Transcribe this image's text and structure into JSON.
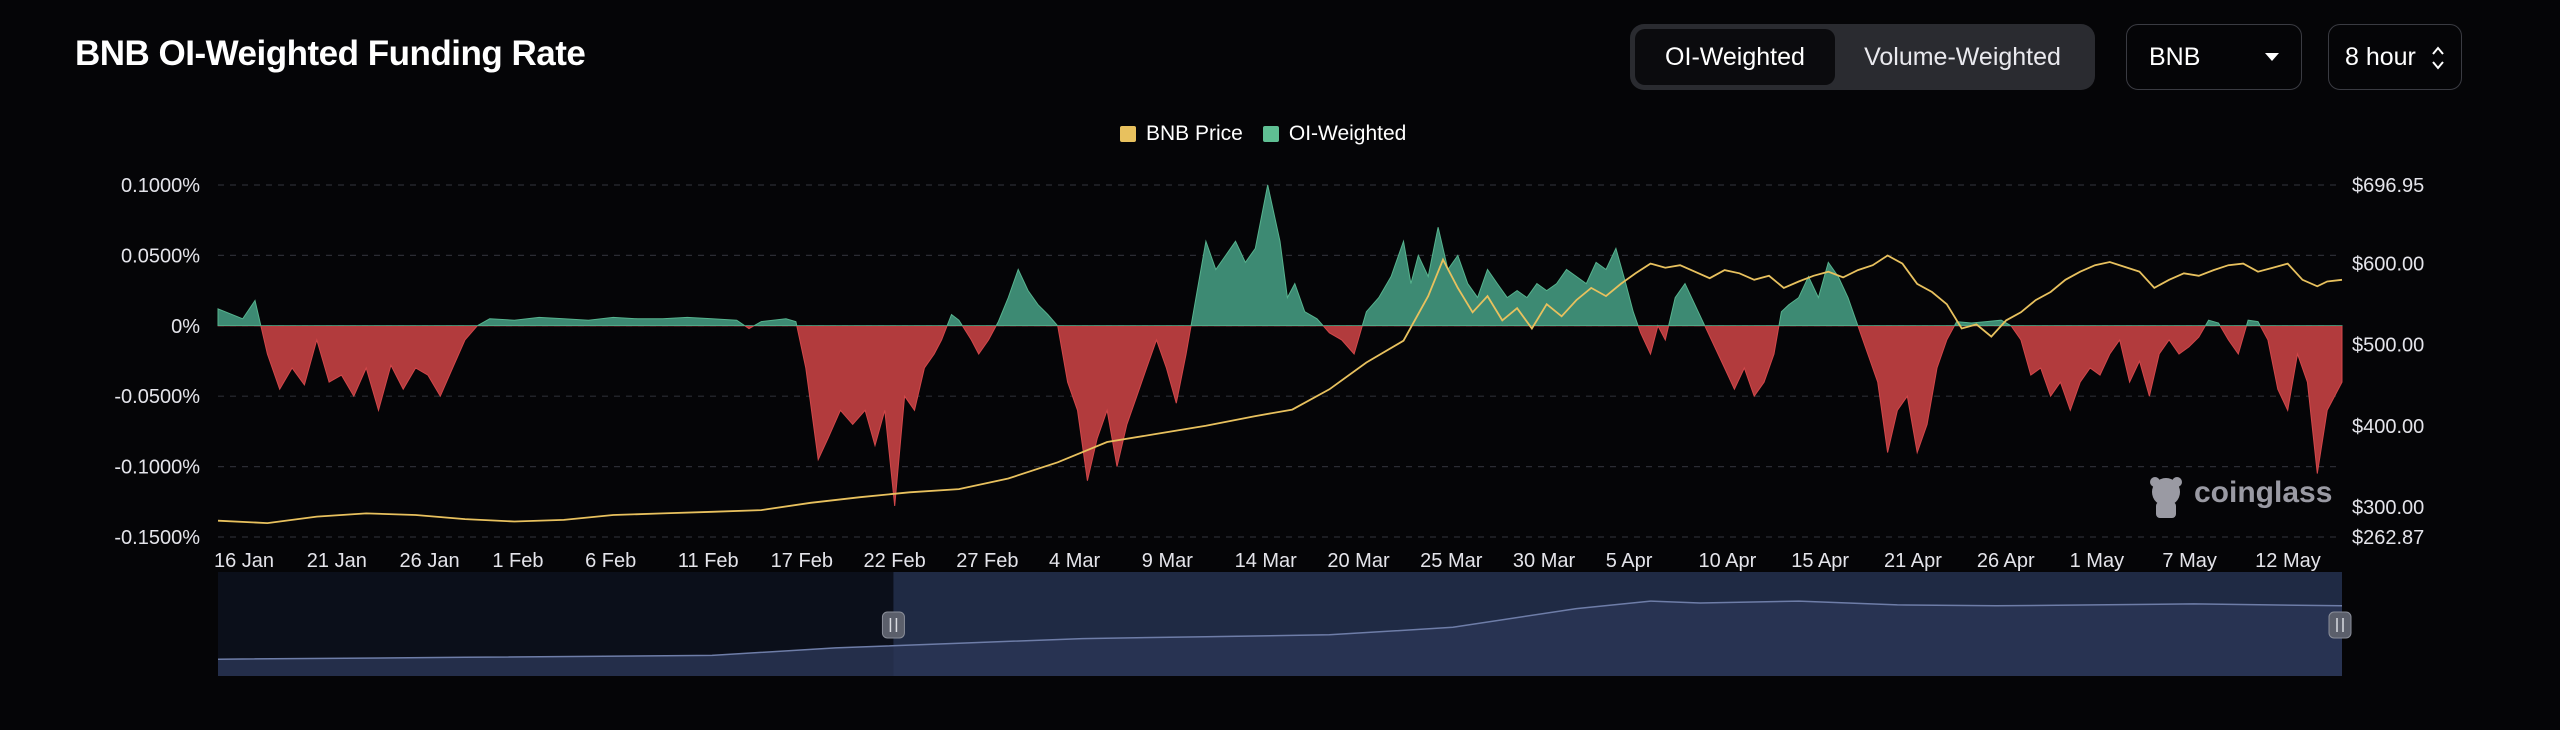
{
  "header": {
    "title": "BNB OI-Weighted Funding Rate",
    "tabs": [
      {
        "label": "OI-Weighted",
        "active": true
      },
      {
        "label": "Volume-Weighted",
        "active": false
      }
    ],
    "coin_select": {
      "value": "BNB",
      "icon": "chevron-down-icon"
    },
    "interval_select": {
      "value": "8 hour",
      "icon": "up-down-icon"
    }
  },
  "watermark": {
    "text": "coinglass"
  },
  "colors": {
    "background": "#050507",
    "positive": "#3d8a73",
    "negative": "#b23b3d",
    "price": "#e8c15e",
    "grid": "#2b2c33",
    "navigator_fill": "#1f2a44",
    "navigator_line": "#6e7da8"
  },
  "chart_data": {
    "type": "area",
    "legend": [
      "BNB Price",
      "OI-Weighted"
    ],
    "legend_position": "top-center",
    "grid": true,
    "y_left_ticks": [
      "0.1000%",
      "0.0500%",
      "0%",
      "-0.0500%",
      "-0.1000%",
      "-0.1500%"
    ],
    "y_left_tick_values": [
      0.1,
      0.05,
      0,
      -0.05,
      -0.1,
      -0.15
    ],
    "ylim_left": [
      -0.15,
      0.1
    ],
    "y_right_ticks": [
      "$696.95",
      "$600.00",
      "$500.00",
      "$400.00",
      "$300.00",
      "$262.87"
    ],
    "y_right_tick_values": [
      696.95,
      600,
      500,
      400,
      300,
      262.87
    ],
    "ylim_right": [
      262.87,
      696.95
    ],
    "x_ticks": [
      "16 Jan",
      "21 Jan",
      "26 Jan",
      "1 Feb",
      "6 Feb",
      "11 Feb",
      "17 Feb",
      "22 Feb",
      "27 Feb",
      "4 Mar",
      "9 Mar",
      "14 Mar",
      "20 Mar",
      "25 Mar",
      "30 Mar",
      "5 Apr",
      "10 Apr",
      "15 Apr",
      "21 Apr",
      "26 Apr",
      "1 May",
      "7 May",
      "12 May"
    ],
    "series": [
      {
        "name": "OI-Weighted",
        "unit": "%",
        "points": [
          [
            0,
            0.012
          ],
          [
            1,
            0.005
          ],
          [
            1.5,
            0.018
          ],
          [
            2,
            -0.02
          ],
          [
            2.5,
            -0.045
          ],
          [
            3,
            -0.03
          ],
          [
            3.5,
            -0.042
          ],
          [
            4,
            -0.01
          ],
          [
            4.5,
            -0.04
          ],
          [
            5,
            -0.035
          ],
          [
            5.5,
            -0.05
          ],
          [
            6,
            -0.03
          ],
          [
            6.5,
            -0.06
          ],
          [
            7,
            -0.028
          ],
          [
            7.5,
            -0.045
          ],
          [
            8,
            -0.03
          ],
          [
            8.5,
            -0.035
          ],
          [
            9,
            -0.05
          ],
          [
            9.5,
            -0.03
          ],
          [
            10,
            -0.01
          ],
          [
            10.5,
            0.0
          ],
          [
            11,
            0.005
          ],
          [
            12,
            0.004
          ],
          [
            13,
            0.006
          ],
          [
            14,
            0.005
          ],
          [
            15,
            0.004
          ],
          [
            16,
            0.006
          ],
          [
            17,
            0.005
          ],
          [
            18,
            0.005
          ],
          [
            19,
            0.006
          ],
          [
            20,
            0.005
          ],
          [
            21,
            0.004
          ],
          [
            21.5,
            -0.002
          ],
          [
            22,
            0.003
          ],
          [
            23,
            0.005
          ],
          [
            23.4,
            0.003
          ],
          [
            23.8,
            -0.03
          ],
          [
            24.3,
            -0.095
          ],
          [
            24.7,
            -0.08
          ],
          [
            25.2,
            -0.06
          ],
          [
            25.7,
            -0.07
          ],
          [
            26.2,
            -0.06
          ],
          [
            26.6,
            -0.085
          ],
          [
            27,
            -0.06
          ],
          [
            27.4,
            -0.128
          ],
          [
            27.8,
            -0.05
          ],
          [
            28.2,
            -0.06
          ],
          [
            28.6,
            -0.03
          ],
          [
            29,
            -0.02
          ],
          [
            29.3,
            -0.01
          ],
          [
            29.7,
            0.008
          ],
          [
            30,
            0.004
          ],
          [
            30.5,
            -0.01
          ],
          [
            30.8,
            -0.02
          ],
          [
            31.2,
            -0.01
          ],
          [
            31.6,
            0.003
          ],
          [
            32,
            0.02
          ],
          [
            32.4,
            0.04
          ],
          [
            32.8,
            0.025
          ],
          [
            33.2,
            0.015
          ],
          [
            33.6,
            0.008
          ],
          [
            34,
            0.0
          ],
          [
            34.4,
            -0.04
          ],
          [
            34.8,
            -0.06
          ],
          [
            35.2,
            -0.11
          ],
          [
            35.6,
            -0.08
          ],
          [
            36,
            -0.06
          ],
          [
            36.4,
            -0.1
          ],
          [
            36.8,
            -0.07
          ],
          [
            37.2,
            -0.05
          ],
          [
            37.6,
            -0.03
          ],
          [
            38,
            -0.01
          ],
          [
            38.4,
            -0.03
          ],
          [
            38.8,
            -0.055
          ],
          [
            39.2,
            -0.02
          ],
          [
            39.6,
            0.02
          ],
          [
            40,
            0.06
          ],
          [
            40.4,
            0.04
          ],
          [
            40.8,
            0.05
          ],
          [
            41.2,
            0.06
          ],
          [
            41.6,
            0.045
          ],
          [
            42,
            0.055
          ],
          [
            42.5,
            0.1
          ],
          [
            43,
            0.06
          ],
          [
            43.3,
            0.02
          ],
          [
            43.6,
            0.03
          ],
          [
            44,
            0.01
          ],
          [
            44.5,
            0.005
          ],
          [
            45,
            -0.005
          ],
          [
            45.5,
            -0.01
          ],
          [
            46,
            -0.02
          ],
          [
            46.5,
            0.01
          ],
          [
            47,
            0.02
          ],
          [
            47.5,
            0.035
          ],
          [
            48,
            0.06
          ],
          [
            48.3,
            0.03
          ],
          [
            48.6,
            0.05
          ],
          [
            49,
            0.035
          ],
          [
            49.4,
            0.07
          ],
          [
            49.8,
            0.04
          ],
          [
            50.2,
            0.05
          ],
          [
            50.6,
            0.03
          ],
          [
            51,
            0.02
          ],
          [
            51.4,
            0.04
          ],
          [
            51.8,
            0.03
          ],
          [
            52.2,
            0.02
          ],
          [
            52.6,
            0.025
          ],
          [
            53,
            0.02
          ],
          [
            53.4,
            0.03
          ],
          [
            53.8,
            0.025
          ],
          [
            54.2,
            0.03
          ],
          [
            54.6,
            0.04
          ],
          [
            55,
            0.035
          ],
          [
            55.4,
            0.03
          ],
          [
            55.8,
            0.045
          ],
          [
            56.2,
            0.04
          ],
          [
            56.6,
            0.055
          ],
          [
            57,
            0.03
          ],
          [
            57.3,
            0.01
          ],
          [
            57.6,
            -0.005
          ],
          [
            58,
            -0.02
          ],
          [
            58.3,
            0.0
          ],
          [
            58.6,
            -0.01
          ],
          [
            59,
            0.02
          ],
          [
            59.4,
            0.03
          ],
          [
            59.8,
            0.015
          ],
          [
            60.2,
            0.0
          ],
          [
            60.6,
            -0.015
          ],
          [
            61,
            -0.03
          ],
          [
            61.4,
            -0.045
          ],
          [
            61.8,
            -0.03
          ],
          [
            62.2,
            -0.05
          ],
          [
            62.6,
            -0.04
          ],
          [
            63,
            -0.02
          ],
          [
            63.3,
            0.01
          ],
          [
            63.6,
            0.015
          ],
          [
            64,
            0.02
          ],
          [
            64.4,
            0.035
          ],
          [
            64.8,
            0.02
          ],
          [
            65.2,
            0.045
          ],
          [
            65.6,
            0.035
          ],
          [
            66,
            0.02
          ],
          [
            66.4,
            0.0
          ],
          [
            66.8,
            -0.02
          ],
          [
            67.2,
            -0.04
          ],
          [
            67.6,
            -0.09
          ],
          [
            68,
            -0.06
          ],
          [
            68.4,
            -0.05
          ],
          [
            68.8,
            -0.09
          ],
          [
            69.2,
            -0.07
          ],
          [
            69.6,
            -0.03
          ],
          [
            70,
            -0.01
          ],
          [
            70.4,
            0.003
          ],
          [
            71,
            0.002
          ],
          [
            71.6,
            0.003
          ],
          [
            72.2,
            0.004
          ],
          [
            72.6,
            0.0
          ],
          [
            73,
            -0.01
          ],
          [
            73.4,
            -0.035
          ],
          [
            73.8,
            -0.03
          ],
          [
            74.2,
            -0.05
          ],
          [
            74.6,
            -0.04
          ],
          [
            75,
            -0.06
          ],
          [
            75.4,
            -0.04
          ],
          [
            75.8,
            -0.03
          ],
          [
            76.2,
            -0.035
          ],
          [
            76.6,
            -0.02
          ],
          [
            77,
            -0.01
          ],
          [
            77.4,
            -0.04
          ],
          [
            77.8,
            -0.025
          ],
          [
            78.2,
            -0.05
          ],
          [
            78.6,
            -0.02
          ],
          [
            79,
            -0.01
          ],
          [
            79.4,
            -0.02
          ],
          [
            79.8,
            -0.015
          ],
          [
            80.2,
            -0.008
          ],
          [
            80.6,
            0.004
          ],
          [
            81,
            0.002
          ],
          [
            81.4,
            -0.01
          ],
          [
            81.8,
            -0.02
          ],
          [
            82.2,
            0.004
          ],
          [
            82.6,
            0.003
          ],
          [
            83,
            -0.01
          ],
          [
            83.4,
            -0.045
          ],
          [
            83.8,
            -0.06
          ],
          [
            84.2,
            -0.02
          ],
          [
            84.6,
            -0.04
          ],
          [
            85,
            -0.105
          ],
          [
            85.4,
            -0.06
          ],
          [
            86,
            -0.04
          ]
        ]
      },
      {
        "name": "BNB Price",
        "unit": "USD",
        "points": [
          [
            0,
            283
          ],
          [
            2,
            280
          ],
          [
            4,
            288
          ],
          [
            6,
            292
          ],
          [
            8,
            290
          ],
          [
            10,
            285
          ],
          [
            12,
            282
          ],
          [
            14,
            284
          ],
          [
            16,
            290
          ],
          [
            18,
            292
          ],
          [
            20,
            294
          ],
          [
            22,
            296
          ],
          [
            24,
            305
          ],
          [
            26,
            312
          ],
          [
            28,
            318
          ],
          [
            30,
            322
          ],
          [
            32,
            335
          ],
          [
            34,
            355
          ],
          [
            36,
            380
          ],
          [
            38,
            390
          ],
          [
            40,
            400
          ],
          [
            42,
            412
          ],
          [
            43.5,
            420
          ],
          [
            45,
            445
          ],
          [
            46.5,
            478
          ],
          [
            48,
            505
          ],
          [
            49,
            560
          ],
          [
            49.6,
            605
          ],
          [
            50.2,
            570
          ],
          [
            50.8,
            540
          ],
          [
            51.4,
            560
          ],
          [
            52,
            530
          ],
          [
            52.6,
            545
          ],
          [
            53.2,
            520
          ],
          [
            53.8,
            550
          ],
          [
            54.4,
            535
          ],
          [
            55,
            555
          ],
          [
            55.6,
            570
          ],
          [
            56.2,
            560
          ],
          [
            56.8,
            575
          ],
          [
            57.4,
            588
          ],
          [
            58,
            600
          ],
          [
            58.6,
            595
          ],
          [
            59.2,
            598
          ],
          [
            59.8,
            590
          ],
          [
            60.4,
            582
          ],
          [
            61,
            592
          ],
          [
            61.6,
            588
          ],
          [
            62.2,
            580
          ],
          [
            62.8,
            585
          ],
          [
            63.4,
            570
          ],
          [
            64,
            578
          ],
          [
            64.6,
            585
          ],
          [
            65.2,
            590
          ],
          [
            65.8,
            583
          ],
          [
            66.4,
            592
          ],
          [
            67,
            598
          ],
          [
            67.6,
            610
          ],
          [
            68.2,
            600
          ],
          [
            68.8,
            575
          ],
          [
            69.4,
            565
          ],
          [
            70,
            550
          ],
          [
            70.6,
            520
          ],
          [
            71.2,
            525
          ],
          [
            71.8,
            510
          ],
          [
            72.4,
            530
          ],
          [
            73,
            540
          ],
          [
            73.6,
            555
          ],
          [
            74.2,
            565
          ],
          [
            74.8,
            580
          ],
          [
            75.4,
            590
          ],
          [
            76,
            598
          ],
          [
            76.6,
            602
          ],
          [
            77.2,
            596
          ],
          [
            77.8,
            590
          ],
          [
            78.4,
            570
          ],
          [
            79,
            580
          ],
          [
            79.6,
            588
          ],
          [
            80.2,
            585
          ],
          [
            80.8,
            592
          ],
          [
            81.4,
            598
          ],
          [
            82,
            600
          ],
          [
            82.6,
            590
          ],
          [
            83.2,
            595
          ],
          [
            83.8,
            600
          ],
          [
            84.4,
            580
          ],
          [
            85,
            572
          ],
          [
            85.4,
            578
          ],
          [
            86,
            580
          ]
        ]
      }
    ],
    "navigator": {
      "selected_range_fraction": [
        0.318,
        1.0
      ],
      "points": [
        [
          0,
          0.18
        ],
        [
          10,
          0.2
        ],
        [
          20,
          0.22
        ],
        [
          25,
          0.3
        ],
        [
          30,
          0.35
        ],
        [
          35,
          0.4
        ],
        [
          40,
          0.42
        ],
        [
          45,
          0.44
        ],
        [
          50,
          0.52
        ],
        [
          55,
          0.72
        ],
        [
          58,
          0.8
        ],
        [
          60,
          0.78
        ],
        [
          64,
          0.8
        ],
        [
          68,
          0.76
        ],
        [
          72,
          0.75
        ],
        [
          76,
          0.76
        ],
        [
          80,
          0.77
        ],
        [
          86,
          0.75
        ]
      ]
    }
  }
}
